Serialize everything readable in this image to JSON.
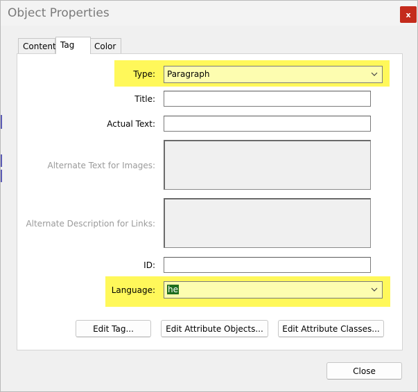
{
  "window": {
    "title": "Object Properties",
    "close_glyph": "x"
  },
  "tabs": [
    {
      "label": "Content",
      "active": false
    },
    {
      "label": "Tag",
      "active": true
    },
    {
      "label": "Color",
      "active": false
    }
  ],
  "form": {
    "type": {
      "label": "Type:",
      "value": "Paragraph"
    },
    "title": {
      "label": "Title:",
      "value": ""
    },
    "actual_text": {
      "label": "Actual Text:",
      "value": ""
    },
    "alt_text_images": {
      "label": "Alternate Text for Images:",
      "value": ""
    },
    "alt_desc_links": {
      "label": "Alternate Description for Links:",
      "value": ""
    },
    "id": {
      "label": "ID:",
      "value": ""
    },
    "language": {
      "label": "Language:",
      "value": "he"
    }
  },
  "buttons": {
    "edit_tag": "Edit Tag...",
    "edit_attr_objects": "Edit Attribute Objects...",
    "edit_attr_classes": "Edit Attribute Classes...",
    "close": "Close"
  },
  "colors": {
    "highlight": "#fff85a",
    "close_red": "#c42b1c",
    "selection_green": "#1e6d1e"
  }
}
